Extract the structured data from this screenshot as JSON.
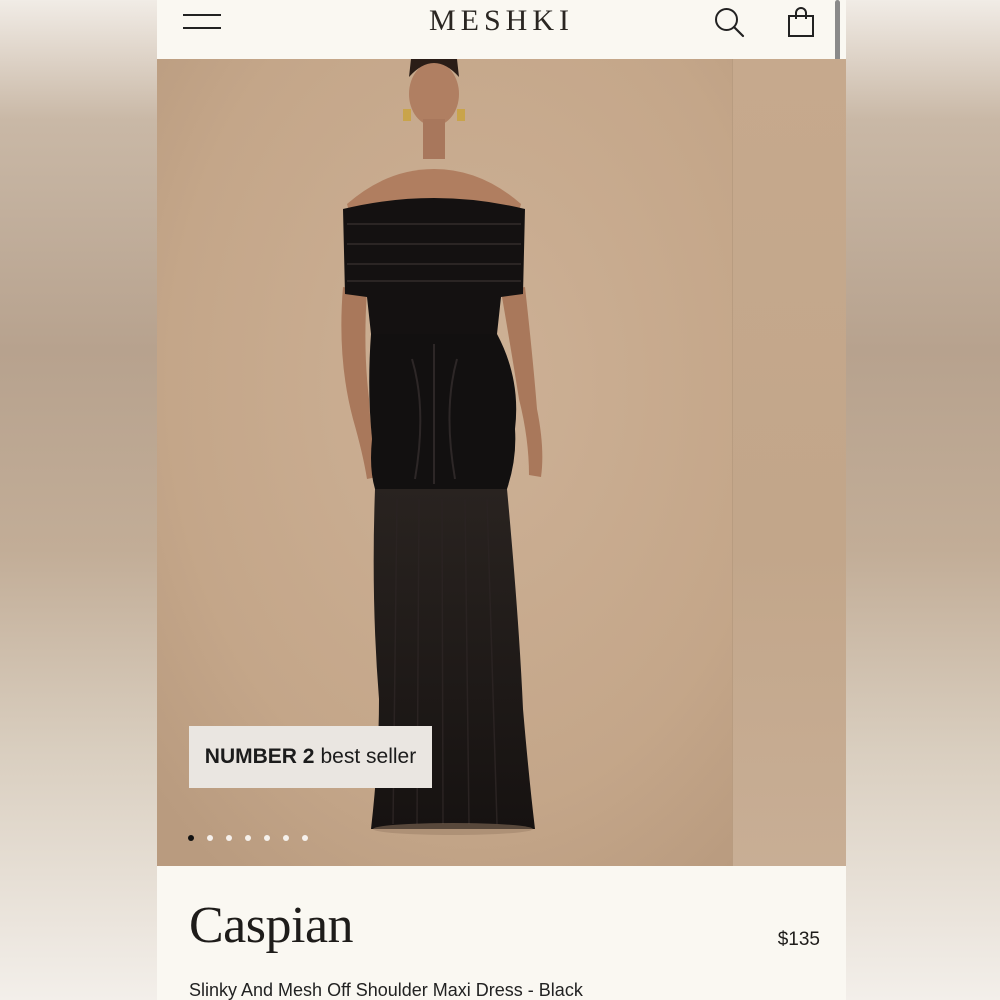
{
  "header": {
    "brand": "MESHKI",
    "menu_icon": "hamburger-menu-icon",
    "search_icon": "search-icon",
    "bag_icon": "shopping-bag-icon"
  },
  "gallery": {
    "badge_bold": "NUMBER 2",
    "badge_text": "best seller",
    "image_count": 7,
    "active_index": 0,
    "colors": {
      "backdrop": "#c8ab8f",
      "dress": "#111111"
    }
  },
  "product": {
    "name": "Caspian",
    "price": "$135",
    "subtitle": "Slinky And Mesh Off Shoulder Maxi Dress - Black"
  }
}
